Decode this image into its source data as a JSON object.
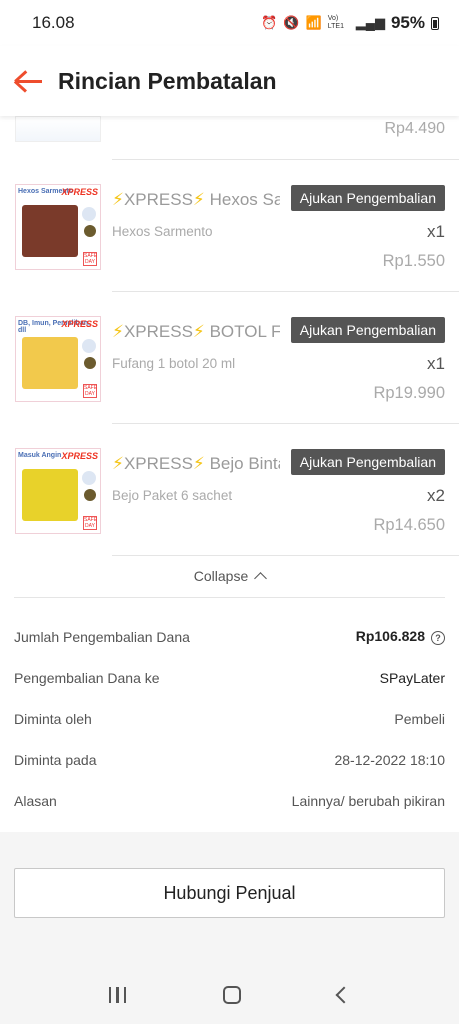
{
  "status_bar": {
    "time": "16.08",
    "network": "Vo) LTE1",
    "battery": "95%"
  },
  "header": {
    "title": "Rincian Pembatalan"
  },
  "top_partial_item": {
    "price": "Rp4.490"
  },
  "products": [
    {
      "prefix": "XPRESS",
      "name": "Hexos Sarmento",
      "variant": "Hexos Sarmento",
      "qty": "x1",
      "price": "Rp1.550",
      "return_label": "Ajukan Pengembalian",
      "thumb_text": "Hexos Sarmento",
      "thumb_color": "#7a3a2a"
    },
    {
      "prefix": "XPRESS",
      "name": "BOTOL Fufang",
      "variant": "Fufang 1 botol 20 ml",
      "qty": "x1",
      "price": "Rp19.990",
      "return_label": "Ajukan Pengembalian",
      "thumb_text": "DB, Imun, Pemulihan, dll",
      "thumb_color": "#f2c94c"
    },
    {
      "prefix": "XPRESS",
      "name": "Bejo Bintang Toedjoe",
      "variant": "Bejo Paket 6 sachet",
      "qty": "x2",
      "price": "Rp14.650",
      "return_label": "Ajukan Pengembalian",
      "thumb_text": "Masuk Angin",
      "thumb_color": "#e8d22a"
    }
  ],
  "collapse_label": "Collapse",
  "details": {
    "refund_amount_label": "Jumlah Pengembalian Dana",
    "refund_amount_value": "Rp106.828",
    "refund_to_label": "Pengembalian Dana ke",
    "refund_to_value": "SPayLater",
    "requested_by_label": "Diminta oleh",
    "requested_by_value": "Pembeli",
    "requested_at_label": "Diminta pada",
    "requested_at_value": "28-12-2022 18:10",
    "reason_label": "Alasan",
    "reason_value": "Lainnya/ berubah pikiran"
  },
  "contact_button": "Hubungi Penjual",
  "colors": {
    "accent": "#ee4d2d",
    "button_dark": "#555555",
    "bolt": "#f5c518"
  }
}
